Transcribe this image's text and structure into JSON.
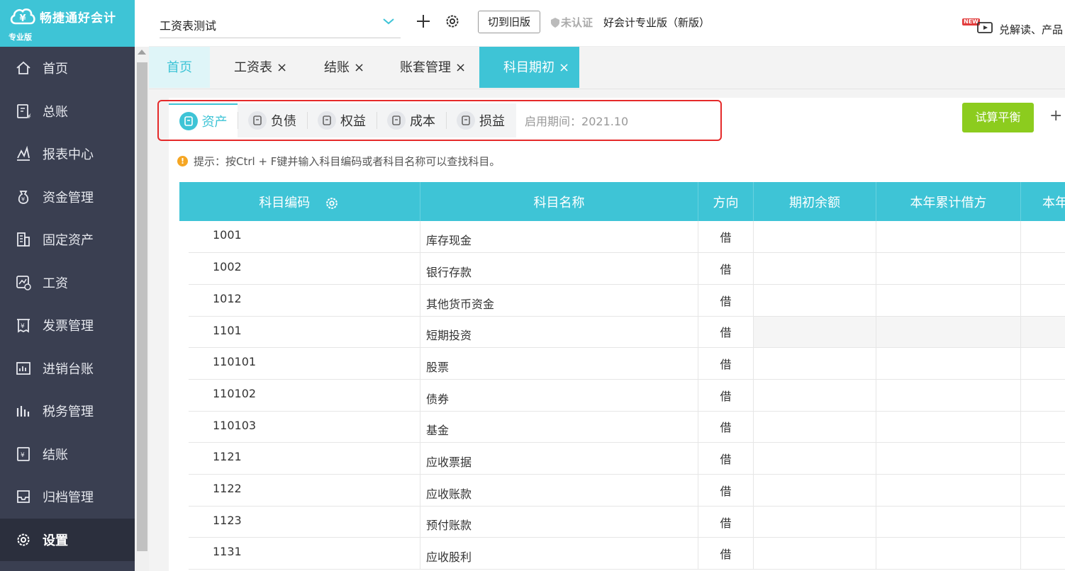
{
  "brand": {
    "name": "畅捷通好会计",
    "edition": "专业版"
  },
  "sidebar": {
    "items": [
      {
        "label": "首页",
        "icon": "home-icon"
      },
      {
        "label": "总账",
        "icon": "ledger-icon"
      },
      {
        "label": "报表中心",
        "icon": "report-icon"
      },
      {
        "label": "资金管理",
        "icon": "money-icon"
      },
      {
        "label": "固定资产",
        "icon": "building-icon"
      },
      {
        "label": "工资",
        "icon": "salary-icon"
      },
      {
        "label": "发票管理",
        "icon": "invoice-icon"
      },
      {
        "label": "进销台账",
        "icon": "inventory-icon"
      },
      {
        "label": "税务管理",
        "icon": "tax-icon"
      },
      {
        "label": "结账",
        "icon": "closing-icon"
      },
      {
        "label": "归档管理",
        "icon": "archive-icon"
      },
      {
        "label": "设置",
        "icon": "gear-icon",
        "active": true
      }
    ]
  },
  "topbar": {
    "company": "工资表测试",
    "switch_label": "切到旧版",
    "cert_label": "未认证",
    "product_label": "好会计专业版（新版）",
    "new_tag": "NEW",
    "promo": "兑解读、产品"
  },
  "tabs": {
    "home": "首页",
    "items": [
      "工资表",
      "结账",
      "账套管理"
    ],
    "active": "科目期初"
  },
  "categories": {
    "items": [
      {
        "label": "资产",
        "icon": "asset-icon",
        "selected": true
      },
      {
        "label": "负债",
        "icon": "liability-icon"
      },
      {
        "label": "权益",
        "icon": "equity-icon"
      },
      {
        "label": "成本",
        "icon": "cost-icon"
      },
      {
        "label": "损益",
        "icon": "profit-icon"
      }
    ],
    "period_label": "启用期间：",
    "period_value": "2021.10"
  },
  "actions": {
    "trial_balance": "试算平衡",
    "more": "+"
  },
  "tip": "提示：按Ctrl + F键并输入科目编码或者科目名称可以查找科目。",
  "table": {
    "headers": [
      "科目编码",
      "科目名称",
      "方向",
      "期初余额",
      "本年累计借方",
      "本年"
    ],
    "rows": [
      {
        "code": "1001",
        "name": "库存现金",
        "dir": "借"
      },
      {
        "code": "1002",
        "name": "银行存款",
        "dir": "借"
      },
      {
        "code": "1012",
        "name": "其他货币资金",
        "dir": "借"
      },
      {
        "code": "1101",
        "name": "短期投资",
        "dir": "借"
      },
      {
        "code": "110101",
        "name": "股票",
        "dir": "借"
      },
      {
        "code": "110102",
        "name": "债券",
        "dir": "借"
      },
      {
        "code": "110103",
        "name": "基金",
        "dir": "借"
      },
      {
        "code": "1121",
        "name": "应收票据",
        "dir": "借"
      },
      {
        "code": "1122",
        "name": "应收账款",
        "dir": "借"
      },
      {
        "code": "1123",
        "name": "预付账款",
        "dir": "借"
      },
      {
        "code": "1131",
        "name": "应收股利",
        "dir": "借"
      }
    ]
  },
  "colors": {
    "accent": "#3ec4d6",
    "sidebar": "#3a3f51",
    "trial_button": "#8ccc1e",
    "highlight": "#e52a2a"
  }
}
